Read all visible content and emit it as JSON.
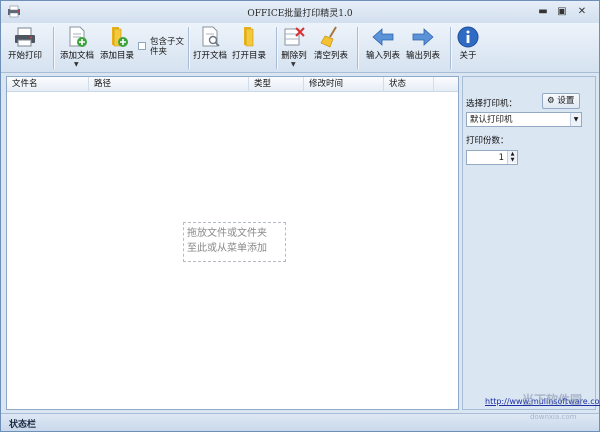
{
  "window": {
    "title": "OFFICE批量打印精灵1.0"
  },
  "toolbar": {
    "start_print": "开始打印",
    "add_doc": "添加文档",
    "add_dir": "添加目录",
    "include_subfolders": "包含子文件夹",
    "open_doc": "打开文档",
    "open_dir": "打开目录",
    "delete_col": "删除列",
    "clear_list": "清空列表",
    "import_list": "输入列表",
    "export_list": "输出列表",
    "about": "关于"
  },
  "list": {
    "columns": [
      "文件名",
      "路径",
      "类型",
      "修改时间",
      "状态"
    ],
    "empty_hint_line1": "拖放文件或文件夹",
    "empty_hint_line2": "至此或从菜单添加"
  },
  "panel": {
    "printer_label": "选择打印机：",
    "settings_label": "设置",
    "printer_value": "默认打印机",
    "copies_label": "打印份数：",
    "copies_value": "1",
    "website": "http://www.mulinsoftware.com/"
  },
  "statusbar": {
    "text": "状态栏"
  },
  "watermark": {
    "title": "当下软件园",
    "sub": "downxia.com"
  },
  "colors": {
    "accent": "#3b73c4",
    "window_bg": "#dbe6f3"
  }
}
